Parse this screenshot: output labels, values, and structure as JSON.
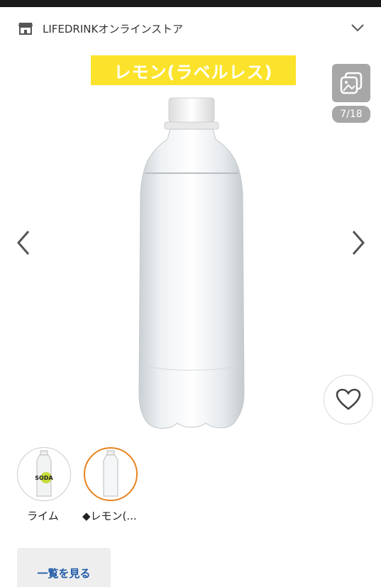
{
  "header": {
    "store_name": "LIFEDRINKオンラインストア",
    "store_icon": "store-icon",
    "expand_icon": "chevron-down-icon"
  },
  "gallery": {
    "banner_text": "レモン(ラベルレス)",
    "image_counter": "7/18",
    "gallery_icon": "image-gallery-icon",
    "prev_icon": "chevron-left-icon",
    "next_icon": "chevron-right-icon",
    "favorite_icon": "heart-icon",
    "banner_color": "#fce32b"
  },
  "variants": [
    {
      "label": "ライム",
      "thumb_text": "SODA",
      "selected": false
    },
    {
      "label": "◆レモン(...",
      "selected": true
    }
  ],
  "actions": {
    "view_all_label": "一覧を見る"
  },
  "colors": {
    "selected_border": "#e8821e",
    "link_blue": "#1f5aa6",
    "badge_gray": "#a7a7a7"
  }
}
